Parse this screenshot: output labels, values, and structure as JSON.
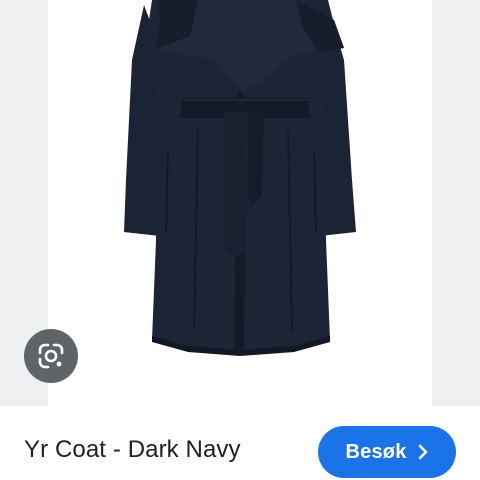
{
  "product": {
    "title": "Yr Coat - Dark Navy",
    "image": "navy wrap coat with belt"
  },
  "actions": {
    "visit_label": "Besøk"
  },
  "icons": {
    "lens": "google-lens-icon",
    "visit": "chevron-right-icon"
  },
  "colors": {
    "accent": "#1a73e8",
    "coat": "#1b2434",
    "viewer_background": "#eff0f2",
    "lens_button": "#606368"
  }
}
